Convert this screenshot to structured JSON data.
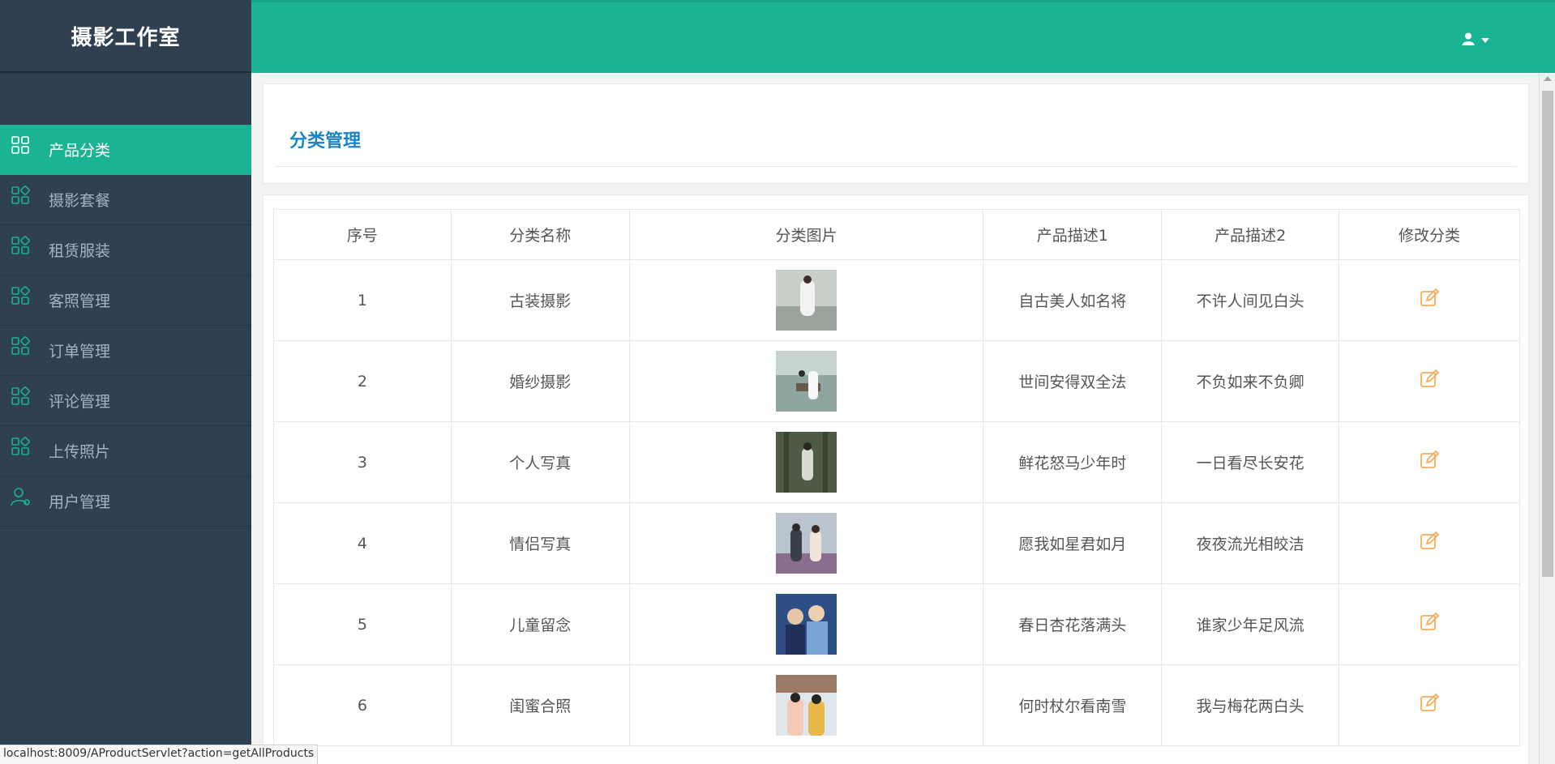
{
  "brand": "摄影工作室",
  "sidebar": {
    "items": [
      {
        "label": "产品分类",
        "active": true,
        "icon": "grid-icon"
      },
      {
        "label": "摄影套餐",
        "active": false,
        "icon": "grid-icon"
      },
      {
        "label": "租赁服装",
        "active": false,
        "icon": "grid-icon"
      },
      {
        "label": "客照管理",
        "active": false,
        "icon": "grid-icon"
      },
      {
        "label": "订单管理",
        "active": false,
        "icon": "grid-icon"
      },
      {
        "label": "评论管理",
        "active": false,
        "icon": "grid-icon"
      },
      {
        "label": "上传照片",
        "active": false,
        "icon": "grid-icon"
      },
      {
        "label": "用户管理",
        "active": false,
        "icon": "user-gear-icon"
      }
    ]
  },
  "topbar": {
    "user_icon": "user-icon",
    "caret_icon": "caret-down-icon"
  },
  "page": {
    "title": "分类管理"
  },
  "table": {
    "headers": [
      "序号",
      "分类名称",
      "分类图片",
      "产品描述1",
      "产品描述2",
      "修改分类"
    ],
    "rows": [
      {
        "id": "1",
        "name": "古装摄影",
        "desc1": "自古美人如名将",
        "desc2": "不许人间见白头"
      },
      {
        "id": "2",
        "name": "婚纱摄影",
        "desc1": "世间安得双全法",
        "desc2": "不负如来不负卿"
      },
      {
        "id": "3",
        "name": "个人写真",
        "desc1": "鲜花怒马少年时",
        "desc2": "一日看尽长安花"
      },
      {
        "id": "4",
        "name": "情侣写真",
        "desc1": "愿我如星君如月",
        "desc2": "夜夜流光相皎洁"
      },
      {
        "id": "5",
        "name": "儿童留念",
        "desc1": "春日杏花落满头",
        "desc2": "谁家少年足风流"
      },
      {
        "id": "6",
        "name": "闺蜜合照",
        "desc1": "何时杖尔看南雪",
        "desc2": "我与梅花两白头"
      }
    ]
  },
  "status_url": "localhost:8009/AProductServlet?action=getAllProducts",
  "colors": {
    "sidebar_bg": "#2f4050",
    "accent": "#1ab394",
    "title_blue": "#1c84c6",
    "edit_orange": "#f8ac59"
  }
}
